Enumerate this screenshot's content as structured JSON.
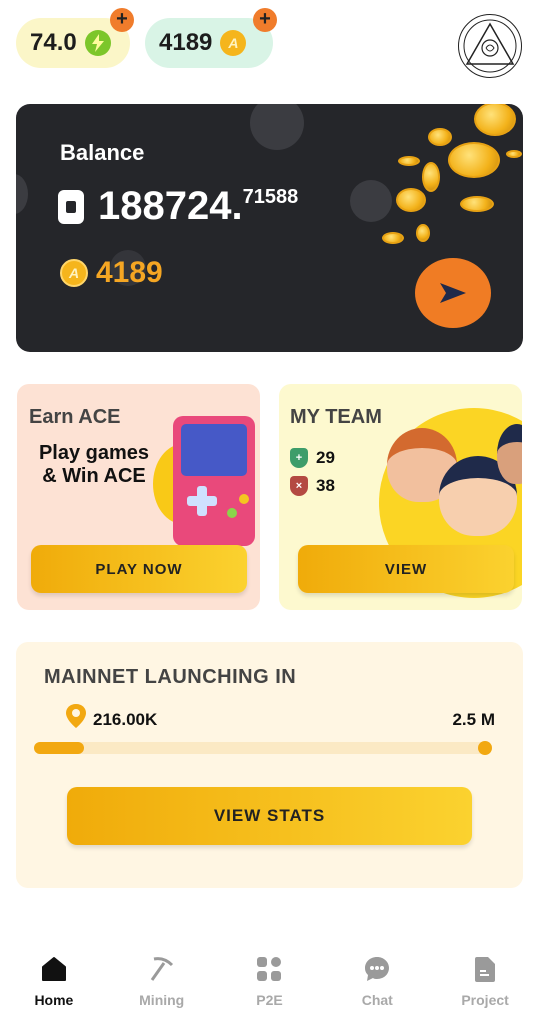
{
  "header": {
    "energy_value": "74.0",
    "coin_value": "4189",
    "coin_symbol": "A",
    "plus": "+"
  },
  "balance": {
    "title": "Balance",
    "amount_int": "188724.",
    "amount_frac": "71588",
    "coins": "4189",
    "coin_symbol": "A"
  },
  "earn": {
    "title": "Earn ACE",
    "subtitle": "Play games & Win ACE",
    "button": "PLAY NOW"
  },
  "team": {
    "title": "MY TEAM",
    "wins": "29",
    "losses": "38",
    "button": "VIEW"
  },
  "mainnet": {
    "title": "MAINNET LAUNCHING IN",
    "current": "216.00K",
    "target": "2.5 M",
    "progress_fraction": 0.0864,
    "button": "VIEW STATS"
  },
  "nav": {
    "items": [
      {
        "label": "Home",
        "icon": "home-icon",
        "active": true
      },
      {
        "label": "Mining",
        "icon": "pickaxe-icon",
        "active": false
      },
      {
        "label": "P2E",
        "icon": "grid-icon",
        "active": false
      },
      {
        "label": "Chat",
        "icon": "chat-icon",
        "active": false
      },
      {
        "label": "Project",
        "icon": "document-icon",
        "active": false
      }
    ]
  },
  "colors": {
    "accent_orange": "#f07c24",
    "gold": "#f5a623",
    "dark_card": "#25262a",
    "progress": "#f2a811"
  }
}
